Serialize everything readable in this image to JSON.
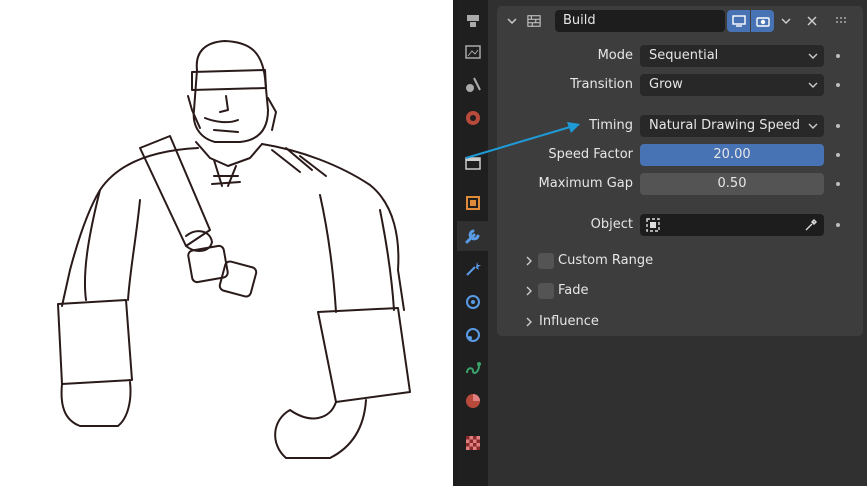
{
  "modifier": {
    "name": "Build"
  },
  "fields": {
    "mode": {
      "label": "Mode",
      "value": "Sequential"
    },
    "transition": {
      "label": "Transition",
      "value": "Grow"
    },
    "timing": {
      "label": "Timing",
      "value": "Natural Drawing Speed"
    },
    "speed_factor": {
      "label": "Speed Factor",
      "value": "20.00"
    },
    "maximum_gap": {
      "label": "Maximum Gap",
      "value": "0.50"
    },
    "object": {
      "label": "Object",
      "value": ""
    }
  },
  "subpanels": {
    "custom_range": "Custom Range",
    "fade": "Fade",
    "influence": "Influence"
  },
  "tabs": [
    "tool",
    "render",
    "output",
    "view-layer",
    "scene",
    "world",
    "collection",
    "object",
    "modifiers",
    "shader-effects",
    "particles",
    "physics",
    "constraints",
    "data",
    "material",
    "texture"
  ],
  "colors": {
    "accent": "#4772b3",
    "arrow": "#1e9bd7"
  }
}
